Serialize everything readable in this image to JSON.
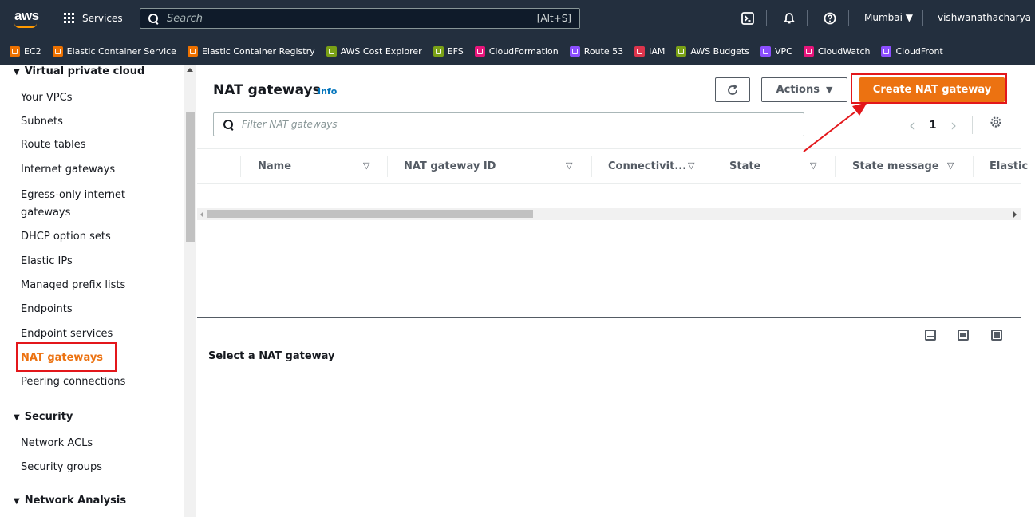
{
  "topnav": {
    "logo_text": "aws",
    "services_label": "Services",
    "search_placeholder": "Search",
    "search_shortcut": "[Alt+S]",
    "region_label": "Mumbai ▼",
    "user_label": "vishwanathacharya"
  },
  "favorites": [
    {
      "label": "EC2",
      "color": "#ed7100"
    },
    {
      "label": "Elastic Container Service",
      "color": "#ed7100"
    },
    {
      "label": "Elastic Container Registry",
      "color": "#ed7100"
    },
    {
      "label": "AWS Cost Explorer",
      "color": "#7aa116"
    },
    {
      "label": "EFS",
      "color": "#7aa116"
    },
    {
      "label": "CloudFormation",
      "color": "#e7157b"
    },
    {
      "label": "Route 53",
      "color": "#8c4fff"
    },
    {
      "label": "IAM",
      "color": "#dd344c"
    },
    {
      "label": "AWS Budgets",
      "color": "#7aa116"
    },
    {
      "label": "VPC",
      "color": "#8c4fff"
    },
    {
      "label": "CloudWatch",
      "color": "#e7157b"
    },
    {
      "label": "CloudFront",
      "color": "#8c4fff"
    }
  ],
  "sidebar": {
    "groups": [
      {
        "label": "Virtual private cloud"
      },
      {
        "label": "Security"
      },
      {
        "label": "Network Analysis"
      }
    ],
    "vpc_items": [
      {
        "label": "Your VPCs"
      },
      {
        "label": "Subnets"
      },
      {
        "label": "Route tables"
      },
      {
        "label": "Internet gateways"
      },
      {
        "label": "Egress-only internet"
      },
      {
        "label": "gateways"
      },
      {
        "label": "DHCP option sets"
      },
      {
        "label": "Elastic IPs"
      },
      {
        "label": "Managed prefix lists"
      },
      {
        "label": "Endpoints"
      },
      {
        "label": "Endpoint services"
      },
      {
        "label": "NAT gateways"
      },
      {
        "label": "Peering connections"
      }
    ],
    "security_items": [
      {
        "label": "Network ACLs"
      },
      {
        "label": "Security groups"
      }
    ],
    "active_item": "NAT gateways"
  },
  "main": {
    "title": "NAT gateways",
    "info_label": "Info",
    "actions_label": "Actions",
    "create_label": "Create NAT gateway",
    "filter_placeholder": "Filter NAT gateways",
    "page_number": "1",
    "columns": [
      {
        "label": "Name"
      },
      {
        "label": "NAT gateway ID"
      },
      {
        "label": "Connectivit..."
      },
      {
        "label": "State"
      },
      {
        "label": "State message"
      },
      {
        "label": "Elastic"
      }
    ],
    "detail_title": "Select a NAT gateway"
  },
  "colors": {
    "nav_bg": "#232f3e",
    "accent_orange": "#ec7211",
    "highlight_red": "#e3171b",
    "link_blue": "#0073bb"
  }
}
